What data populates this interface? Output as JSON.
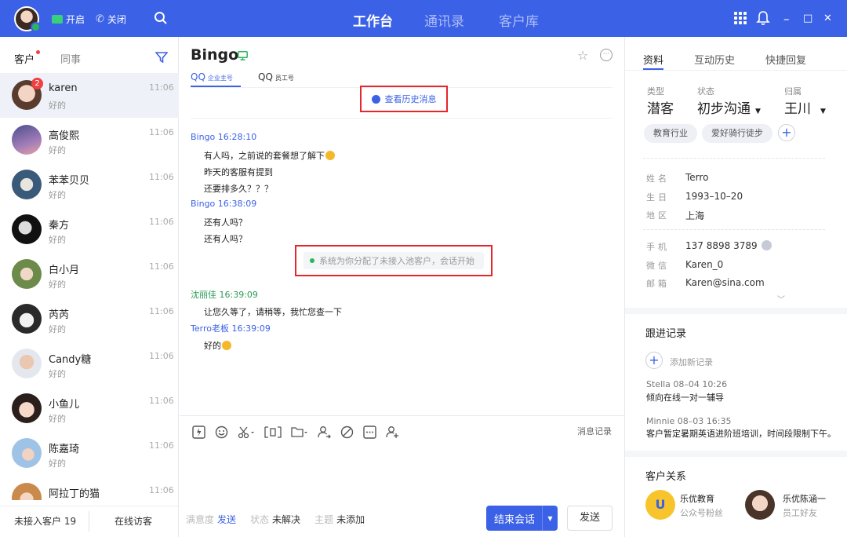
{
  "topbar": {
    "btn_open": "开启",
    "btn_close": "关闭",
    "nav": [
      "工作台",
      "通讯录",
      "客户库"
    ],
    "min": "–",
    "max": "□",
    "close": "✕"
  },
  "left": {
    "tab_customers": "客户",
    "tab_colleagues": "同事",
    "conversations": [
      {
        "name": "karen",
        "sub": "好的",
        "time": "11:06",
        "badge": "2"
      },
      {
        "name": "高俊熙",
        "sub": "好的",
        "time": "11:06"
      },
      {
        "name": "苯苯贝贝",
        "sub": "好的",
        "time": "11:06"
      },
      {
        "name": "秦方",
        "sub": "好的",
        "time": "11:06"
      },
      {
        "name": "白小月",
        "sub": "好的",
        "time": "11:06"
      },
      {
        "name": "芮芮",
        "sub": "好的",
        "time": "11:06"
      },
      {
        "name": "Candy糖",
        "sub": "好的",
        "time": "11:06"
      },
      {
        "name": "小鱼儿",
        "sub": "好的",
        "time": "11:06"
      },
      {
        "name": "陈嘉琦",
        "sub": "好的",
        "time": "11:06"
      },
      {
        "name": "阿拉丁的猫",
        "sub": "好的",
        "time": "11:06"
      }
    ],
    "footer_waiting": "未接入客户 19",
    "footer_online": "在线访客"
  },
  "chat": {
    "title": "Bingo",
    "tab1": "QQ",
    "tab1_sub": "企业主号",
    "tab2": "QQ",
    "tab2_sub": "员工号",
    "history": "查看历史消息",
    "messages": [
      {
        "head": "Bingo 16:28:10",
        "lines": [
          "有人吗，之前说的套餐想了解下",
          "昨天的客服有提到",
          "还要排多久？？？"
        ]
      },
      {
        "head": "Bingo 16:38:09",
        "lines": [
          "还有人吗？",
          "还有人吗？"
        ]
      },
      {
        "head": "沈丽佳 16:39:09",
        "lines": [
          "让您久等了，请稍等，我忙您查一下"
        ]
      },
      {
        "head": "Terro老板 16:39:09",
        "lines": [
          "好的"
        ]
      }
    ],
    "system": "系统为你分配了未接入池客户，会话开始",
    "msg_record": "消息记录",
    "footer": {
      "k1": "满意度",
      "v1": "发送",
      "k2": "状态",
      "v2": "未解决",
      "k3": "主题",
      "v3": "未添加"
    },
    "end_btn": "结束会话",
    "send_btn": "发送"
  },
  "profile": {
    "tabs": [
      "资料",
      "互动历史",
      "快捷回复"
    ],
    "attr_keys": [
      "类型",
      "状态",
      "归属"
    ],
    "attr_vals": [
      "潜客",
      "初步沟通",
      "王川"
    ],
    "tags": [
      "教育行业",
      "爱好骑行徒步"
    ],
    "info": [
      {
        "k": "姓名",
        "v": "Terro"
      },
      {
        "k": "生日",
        "v": "1993–10–20"
      },
      {
        "k": "地区",
        "v": "上海"
      },
      {
        "k": "手机",
        "v": "137 8898 3789"
      },
      {
        "k": "微信",
        "v": "Karen_0"
      },
      {
        "k": "邮箱",
        "v": "Karen@sina.com"
      }
    ],
    "follow_title": "跟进记录",
    "add_record": "添加新记录",
    "records": [
      {
        "meta": "Stella  08–04  10:26",
        "text": "倾向在线一对一辅导"
      },
      {
        "meta": "Minnie  08–03  16:35",
        "text": "客户暂定暑期英语进阶班培训，时间段限制下午。"
      }
    ],
    "relation_title": "客户关系",
    "relations": [
      {
        "name": "乐优教育",
        "sub": "公众号粉丝"
      },
      {
        "name": "乐优陈涵一",
        "sub": "员工好友"
      }
    ]
  }
}
